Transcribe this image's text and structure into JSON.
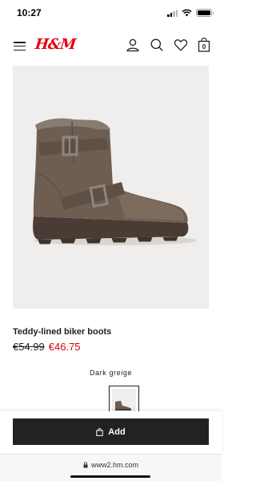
{
  "status_bar": {
    "time": "10:27"
  },
  "header": {
    "logo": "H&M",
    "icons": [
      "menu-icon",
      "account-icon",
      "search-icon",
      "favorites-icon",
      "bag-icon"
    ],
    "bag_count": "0"
  },
  "product": {
    "title": "Teddy-lined biker boots",
    "price_original": "€54.99",
    "price_sale": "€46.75",
    "color_name": "Dark greige"
  },
  "actions": {
    "add_label": "Add"
  },
  "browser": {
    "url": "www2.hm.com"
  },
  "colors": {
    "brand": "#e50010",
    "sale": "#d50010",
    "button": "#222222",
    "image_bg": "#efeeec",
    "boot": "#6b5b4f"
  }
}
